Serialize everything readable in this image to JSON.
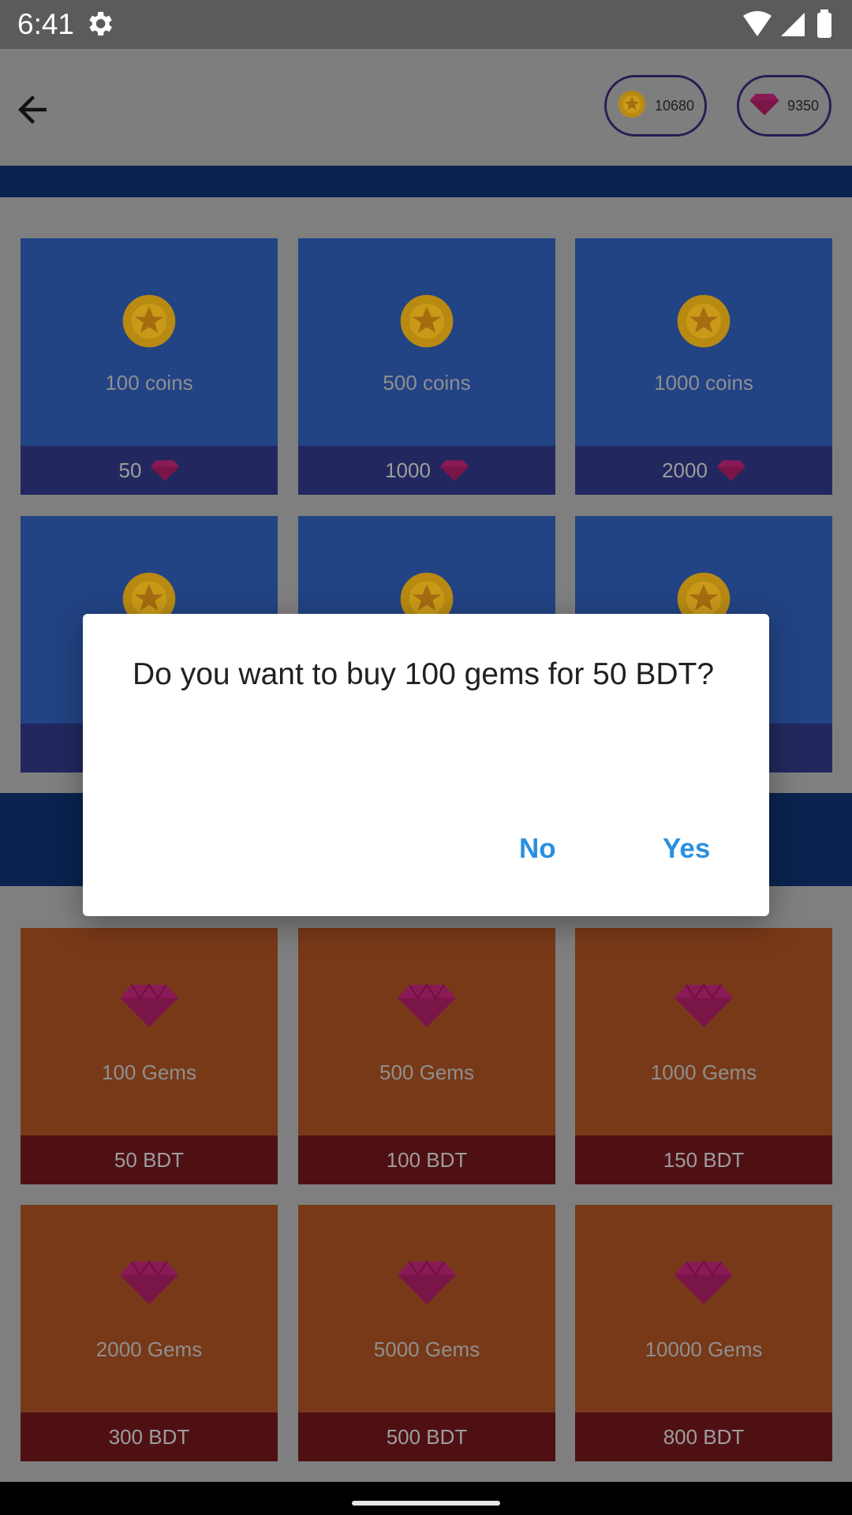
{
  "status_bar": {
    "time": "6:41"
  },
  "header": {
    "coins_balance": "10680",
    "gems_balance": "9350"
  },
  "coin_packs": [
    {
      "name": "100 coins",
      "price": "50"
    },
    {
      "name": "500 coins",
      "price": "1000"
    },
    {
      "name": "1000 coins",
      "price": "2000"
    }
  ],
  "gem_packs": [
    {
      "name": "100 Gems",
      "price": "50 BDT"
    },
    {
      "name": "500 Gems",
      "price": "100 BDT"
    },
    {
      "name": "1000 Gems",
      "price": "150 BDT"
    },
    {
      "name": "2000 Gems",
      "price": "300 BDT"
    },
    {
      "name": "5000 Gems",
      "price": "500 BDT"
    },
    {
      "name": "10000 Gems",
      "price": "800 BDT"
    }
  ],
  "dialog": {
    "message": "Do you want to buy 100 gems for 50 BDT?",
    "no_label": "No",
    "yes_label": "Yes"
  },
  "colors": {
    "accent": "#2a8fe0",
    "coin_card": "#224384",
    "gem_card": "#783918",
    "section_band": "#0a234f"
  }
}
